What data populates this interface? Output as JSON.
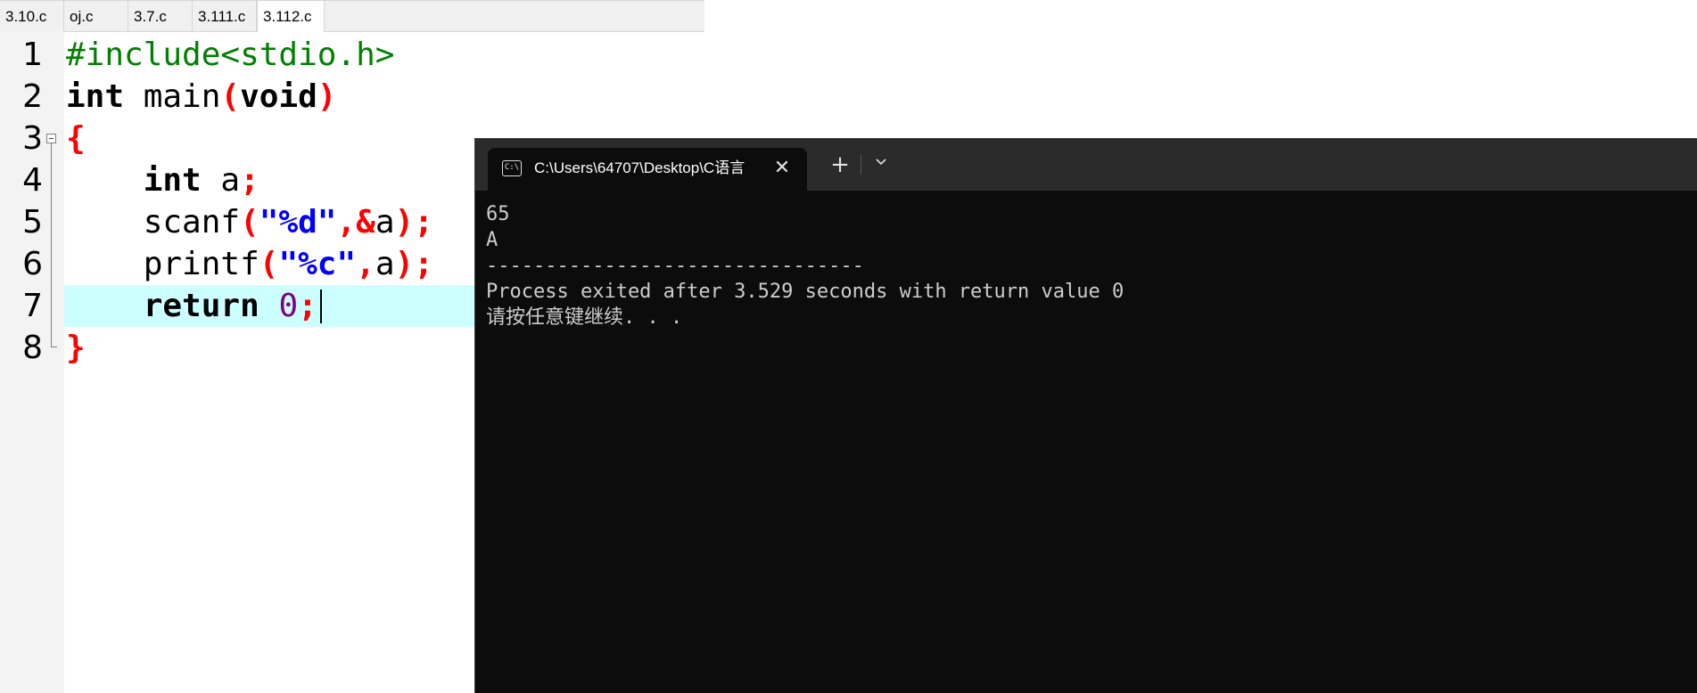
{
  "tabs": [
    {
      "label": "3.10.c",
      "active": false
    },
    {
      "label": "oj.c",
      "active": false
    },
    {
      "label": "3.7.c",
      "active": false
    },
    {
      "label": "3.111.c",
      "active": false
    },
    {
      "label": "3.112.c",
      "active": true
    }
  ],
  "editor": {
    "line_numbers": [
      "1",
      "2",
      "3",
      "4",
      "5",
      "6",
      "7",
      "8"
    ],
    "lines": {
      "l1": {
        "pp": "#include<stdio.h>"
      },
      "l2": {
        "kw1": "int",
        "sp": " main",
        "p1": "(",
        "kw2": "void",
        "p2": ")"
      },
      "l3": {
        "p1": "{"
      },
      "l4": {
        "indent": "    ",
        "kw": "int",
        "rest": " a",
        "p1": ";"
      },
      "l5": {
        "indent": "    ",
        "fn": "scanf",
        "p1": "(",
        "str": "\"%d\"",
        "p2": ",&",
        "var": "a",
        "p3": ");"
      },
      "l6": {
        "indent": "    ",
        "fn": "printf",
        "p1": "(",
        "str": "\"%c\"",
        "p2": ",",
        "var": "a",
        "p3": ");"
      },
      "l7": {
        "indent": "    ",
        "kw": "return",
        "sp": " ",
        "num": "0",
        "p1": ";"
      },
      "l8": {
        "p1": "}"
      }
    },
    "current_line": 7
  },
  "terminal": {
    "tab_title": "C:\\Users\\64707\\Desktop\\C语言",
    "icon": "terminal-icon",
    "icon_text": "C:\\",
    "close_symbol": "✕",
    "new_tab_symbol": "+",
    "dropdown_symbol": "⌄",
    "output": [
      "65",
      "A",
      "--------------------------------",
      "Process exited after 3.529 seconds with return value 0",
      "请按任意键继续. . ."
    ]
  },
  "colors": {
    "preprocessor": "#008000",
    "keyword": "#000000",
    "punctuation": "#ff0000",
    "string": "#0000ff",
    "number": "#800080",
    "current_line_bg": "#ccffff",
    "terminal_bg": "#0c0c0c"
  }
}
